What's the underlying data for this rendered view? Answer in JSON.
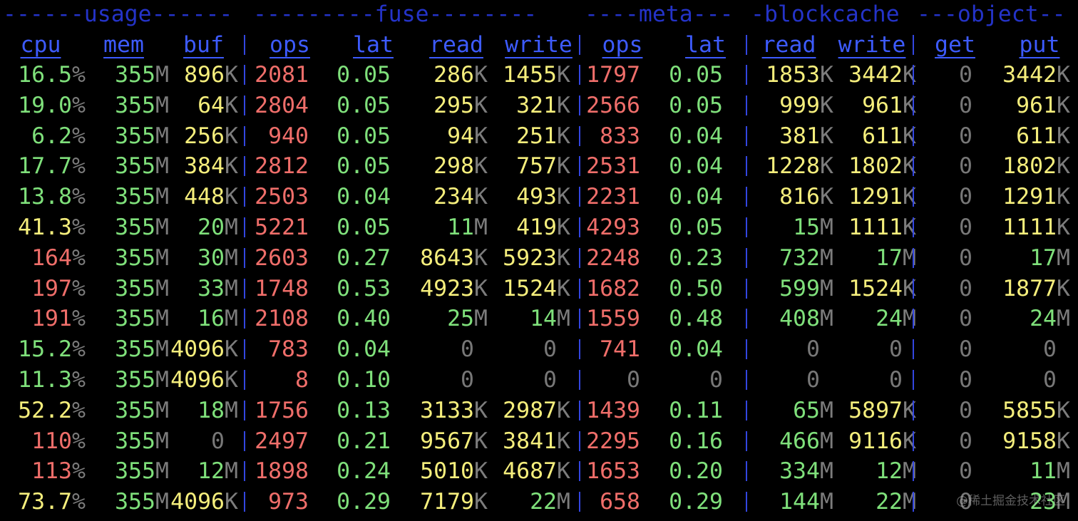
{
  "colors": {
    "background": "#000000",
    "group_header": "#2433c8",
    "column_header": "#3d5bff",
    "separator": "#3346e0",
    "green": "#7fe07b",
    "yellow": "#f5ee7c",
    "red": "#ef6e6a",
    "zero": "#777777",
    "unit": "#7c7c7c"
  },
  "groups": [
    {
      "name": "usage",
      "text": "------usage------"
    },
    {
      "name": "fuse",
      "text": "---------fuse--------"
    },
    {
      "name": "meta",
      "text": "----meta---"
    },
    {
      "name": "blockcache",
      "text": "-blockcache"
    },
    {
      "name": "object",
      "text": "---object--"
    }
  ],
  "columns": [
    "cpu",
    "mem",
    "buf",
    "ops",
    "lat",
    "read",
    "write",
    "ops",
    "lat",
    "read",
    "write",
    "get",
    "put"
  ],
  "separator_char": "|",
  "rows": [
    [
      [
        "16.5",
        "%",
        "g"
      ],
      [
        "355",
        "M",
        "g"
      ],
      [
        "896",
        "K",
        "y"
      ],
      [
        "2081",
        "",
        "r"
      ],
      [
        "0.05",
        "",
        "g"
      ],
      [
        "286",
        "K",
        "y"
      ],
      [
        "1455",
        "K",
        "y"
      ],
      [
        "1797",
        "",
        "r"
      ],
      [
        "0.05",
        "",
        "g"
      ],
      [
        "1853",
        "K",
        "y"
      ],
      [
        "3442",
        "K",
        "y"
      ],
      [
        "0",
        "",
        "d"
      ],
      [
        "3442",
        "K",
        "y"
      ]
    ],
    [
      [
        "19.0",
        "%",
        "g"
      ],
      [
        "355",
        "M",
        "g"
      ],
      [
        "64",
        "K",
        "y"
      ],
      [
        "2804",
        "",
        "r"
      ],
      [
        "0.05",
        "",
        "g"
      ],
      [
        "295",
        "K",
        "y"
      ],
      [
        "321",
        "K",
        "y"
      ],
      [
        "2566",
        "",
        "r"
      ],
      [
        "0.05",
        "",
        "g"
      ],
      [
        "999",
        "K",
        "y"
      ],
      [
        "961",
        "K",
        "y"
      ],
      [
        "0",
        "",
        "d"
      ],
      [
        "961",
        "K",
        "y"
      ]
    ],
    [
      [
        "6.2",
        "%",
        "g"
      ],
      [
        "355",
        "M",
        "g"
      ],
      [
        "256",
        "K",
        "y"
      ],
      [
        "940",
        "",
        "r"
      ],
      [
        "0.05",
        "",
        "g"
      ],
      [
        "94",
        "K",
        "y"
      ],
      [
        "251",
        "K",
        "y"
      ],
      [
        "833",
        "",
        "r"
      ],
      [
        "0.04",
        "",
        "g"
      ],
      [
        "381",
        "K",
        "y"
      ],
      [
        "611",
        "K",
        "y"
      ],
      [
        "0",
        "",
        "d"
      ],
      [
        "611",
        "K",
        "y"
      ]
    ],
    [
      [
        "17.7",
        "%",
        "g"
      ],
      [
        "355",
        "M",
        "g"
      ],
      [
        "384",
        "K",
        "y"
      ],
      [
        "2812",
        "",
        "r"
      ],
      [
        "0.05",
        "",
        "g"
      ],
      [
        "298",
        "K",
        "y"
      ],
      [
        "757",
        "K",
        "y"
      ],
      [
        "2531",
        "",
        "r"
      ],
      [
        "0.04",
        "",
        "g"
      ],
      [
        "1228",
        "K",
        "y"
      ],
      [
        "1802",
        "K",
        "y"
      ],
      [
        "0",
        "",
        "d"
      ],
      [
        "1802",
        "K",
        "y"
      ]
    ],
    [
      [
        "13.8",
        "%",
        "g"
      ],
      [
        "355",
        "M",
        "g"
      ],
      [
        "448",
        "K",
        "y"
      ],
      [
        "2503",
        "",
        "r"
      ],
      [
        "0.04",
        "",
        "g"
      ],
      [
        "234",
        "K",
        "y"
      ],
      [
        "493",
        "K",
        "y"
      ],
      [
        "2231",
        "",
        "r"
      ],
      [
        "0.04",
        "",
        "g"
      ],
      [
        "816",
        "K",
        "y"
      ],
      [
        "1291",
        "K",
        "y"
      ],
      [
        "0",
        "",
        "d"
      ],
      [
        "1291",
        "K",
        "y"
      ]
    ],
    [
      [
        "41.3",
        "%",
        "y"
      ],
      [
        "355",
        "M",
        "g"
      ],
      [
        "20",
        "M",
        "g"
      ],
      [
        "5221",
        "",
        "r"
      ],
      [
        "0.05",
        "",
        "g"
      ],
      [
        "11",
        "M",
        "g"
      ],
      [
        "419",
        "K",
        "y"
      ],
      [
        "4293",
        "",
        "r"
      ],
      [
        "0.05",
        "",
        "g"
      ],
      [
        "15",
        "M",
        "g"
      ],
      [
        "1111",
        "K",
        "y"
      ],
      [
        "0",
        "",
        "d"
      ],
      [
        "1111",
        "K",
        "y"
      ]
    ],
    [
      [
        "164",
        "%",
        "r"
      ],
      [
        "355",
        "M",
        "g"
      ],
      [
        "30",
        "M",
        "g"
      ],
      [
        "2603",
        "",
        "r"
      ],
      [
        "0.27",
        "",
        "g"
      ],
      [
        "8643",
        "K",
        "y"
      ],
      [
        "5923",
        "K",
        "y"
      ],
      [
        "2248",
        "",
        "r"
      ],
      [
        "0.23",
        "",
        "g"
      ],
      [
        "732",
        "M",
        "g"
      ],
      [
        "17",
        "M",
        "g"
      ],
      [
        "0",
        "",
        "d"
      ],
      [
        "17",
        "M",
        "g"
      ]
    ],
    [
      [
        "197",
        "%",
        "r"
      ],
      [
        "355",
        "M",
        "g"
      ],
      [
        "33",
        "M",
        "g"
      ],
      [
        "1748",
        "",
        "r"
      ],
      [
        "0.53",
        "",
        "g"
      ],
      [
        "4923",
        "K",
        "y"
      ],
      [
        "1524",
        "K",
        "y"
      ],
      [
        "1682",
        "",
        "r"
      ],
      [
        "0.50",
        "",
        "g"
      ],
      [
        "599",
        "M",
        "g"
      ],
      [
        "1524",
        "K",
        "y"
      ],
      [
        "0",
        "",
        "d"
      ],
      [
        "1877",
        "K",
        "y"
      ]
    ],
    [
      [
        "191",
        "%",
        "r"
      ],
      [
        "355",
        "M",
        "g"
      ],
      [
        "16",
        "M",
        "g"
      ],
      [
        "2108",
        "",
        "r"
      ],
      [
        "0.40",
        "",
        "g"
      ],
      [
        "25",
        "M",
        "g"
      ],
      [
        "14",
        "M",
        "g"
      ],
      [
        "1559",
        "",
        "r"
      ],
      [
        "0.48",
        "",
        "g"
      ],
      [
        "408",
        "M",
        "g"
      ],
      [
        "24",
        "M",
        "g"
      ],
      [
        "0",
        "",
        "d"
      ],
      [
        "24",
        "M",
        "g"
      ]
    ],
    [
      [
        "15.2",
        "%",
        "g"
      ],
      [
        "355",
        "M",
        "g"
      ],
      [
        "4096",
        "K",
        "y"
      ],
      [
        "783",
        "",
        "r"
      ],
      [
        "0.04",
        "",
        "g"
      ],
      [
        "0",
        "",
        "d"
      ],
      [
        "0",
        "",
        "d"
      ],
      [
        "741",
        "",
        "r"
      ],
      [
        "0.04",
        "",
        "g"
      ],
      [
        "0",
        "",
        "d"
      ],
      [
        "0",
        "",
        "d"
      ],
      [
        "0",
        "",
        "d"
      ],
      [
        "0",
        "",
        "d"
      ]
    ],
    [
      [
        "11.3",
        "%",
        "g"
      ],
      [
        "355",
        "M",
        "g"
      ],
      [
        "4096",
        "K",
        "y"
      ],
      [
        "8",
        "",
        "r"
      ],
      [
        "0.10",
        "",
        "g"
      ],
      [
        "0",
        "",
        "d"
      ],
      [
        "0",
        "",
        "d"
      ],
      [
        "0",
        "",
        "d"
      ],
      [
        "0",
        "",
        "d"
      ],
      [
        "0",
        "",
        "d"
      ],
      [
        "0",
        "",
        "d"
      ],
      [
        "0",
        "",
        "d"
      ],
      [
        "0",
        "",
        "d"
      ]
    ],
    [
      [
        "52.2",
        "%",
        "y"
      ],
      [
        "355",
        "M",
        "g"
      ],
      [
        "18",
        "M",
        "g"
      ],
      [
        "1756",
        "",
        "r"
      ],
      [
        "0.13",
        "",
        "g"
      ],
      [
        "3133",
        "K",
        "y"
      ],
      [
        "2987",
        "K",
        "y"
      ],
      [
        "1439",
        "",
        "r"
      ],
      [
        "0.11",
        "",
        "g"
      ],
      [
        "65",
        "M",
        "g"
      ],
      [
        "5897",
        "K",
        "y"
      ],
      [
        "0",
        "",
        "d"
      ],
      [
        "5855",
        "K",
        "y"
      ]
    ],
    [
      [
        "110",
        "%",
        "r"
      ],
      [
        "355",
        "M",
        "g"
      ],
      [
        "0",
        "",
        "d"
      ],
      [
        "2497",
        "",
        "r"
      ],
      [
        "0.21",
        "",
        "g"
      ],
      [
        "9567",
        "K",
        "y"
      ],
      [
        "3841",
        "K",
        "y"
      ],
      [
        "2295",
        "",
        "r"
      ],
      [
        "0.16",
        "",
        "g"
      ],
      [
        "466",
        "M",
        "g"
      ],
      [
        "9116",
        "K",
        "y"
      ],
      [
        "0",
        "",
        "d"
      ],
      [
        "9158",
        "K",
        "y"
      ]
    ],
    [
      [
        "113",
        "%",
        "r"
      ],
      [
        "355",
        "M",
        "g"
      ],
      [
        "12",
        "M",
        "g"
      ],
      [
        "1898",
        "",
        "r"
      ],
      [
        "0.24",
        "",
        "g"
      ],
      [
        "5010",
        "K",
        "y"
      ],
      [
        "4687",
        "K",
        "y"
      ],
      [
        "1653",
        "",
        "r"
      ],
      [
        "0.20",
        "",
        "g"
      ],
      [
        "334",
        "M",
        "g"
      ],
      [
        "12",
        "M",
        "g"
      ],
      [
        "0",
        "",
        "d"
      ],
      [
        "11",
        "M",
        "g"
      ]
    ],
    [
      [
        "73.7",
        "%",
        "y"
      ],
      [
        "355",
        "M",
        "g"
      ],
      [
        "4096",
        "K",
        "y"
      ],
      [
        "973",
        "",
        "r"
      ],
      [
        "0.29",
        "",
        "g"
      ],
      [
        "7179",
        "K",
        "y"
      ],
      [
        "22",
        "M",
        "g"
      ],
      [
        "658",
        "",
        "r"
      ],
      [
        "0.29",
        "",
        "g"
      ],
      [
        "144",
        "M",
        "g"
      ],
      [
        "22",
        "M",
        "g"
      ],
      [
        "0",
        "",
        "d"
      ],
      [
        "23",
        "M",
        "g"
      ]
    ]
  ],
  "watermark": "@稀土掘金技术社区"
}
